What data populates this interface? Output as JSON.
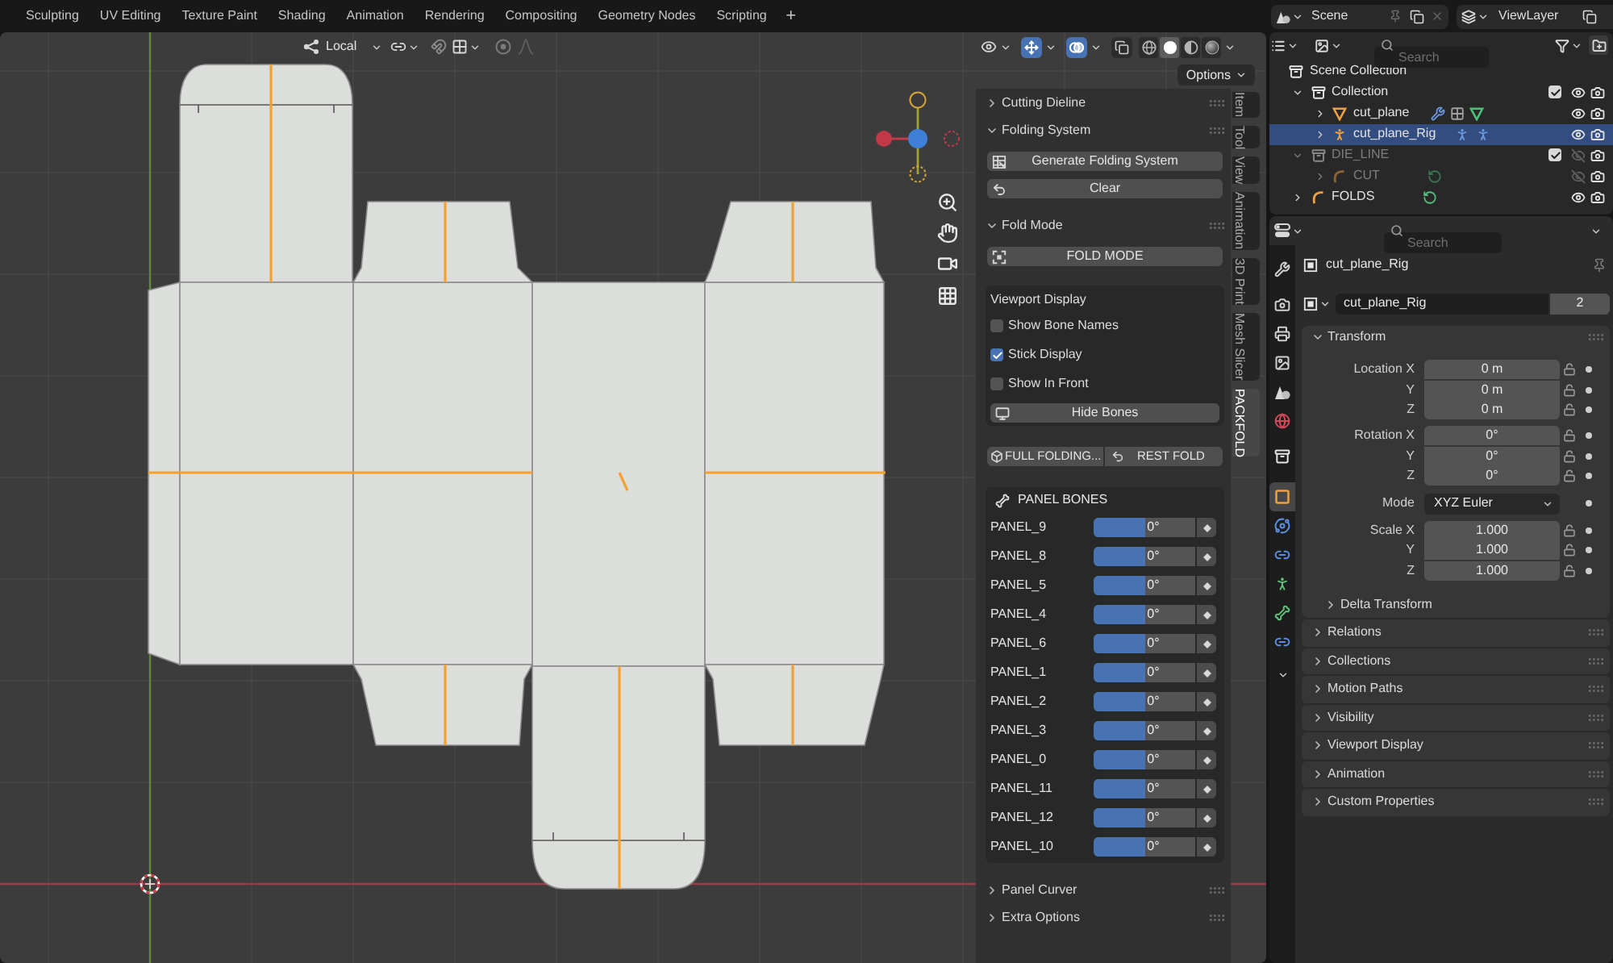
{
  "topbar": {
    "workspaces": [
      "Sculpting",
      "UV Editing",
      "Texture Paint",
      "Shading",
      "Animation",
      "Rendering",
      "Compositing",
      "Geometry Nodes",
      "Scripting"
    ],
    "add_label": "+",
    "scene": "Scene",
    "view_layer": "ViewLayer"
  },
  "viewport": {
    "header": {
      "orientation": "Local",
      "toggles": [
        {
          "kind": "gizmos",
          "on": true
        },
        {
          "kind": "overlays",
          "on": true
        },
        {
          "kind": "xray",
          "on": false
        }
      ],
      "shading": [
        {
          "kind": "wireframe",
          "selected": false
        },
        {
          "kind": "solid",
          "selected": true
        },
        {
          "kind": "material",
          "selected": false
        },
        {
          "kind": "rendered",
          "selected": false
        }
      ]
    },
    "options_label": "Options"
  },
  "sidebar": {
    "panels": [
      {
        "title": "Cutting Dieline",
        "expanded": false
      },
      {
        "title": "Folding System",
        "expanded": true,
        "buttons": [
          {
            "label": "Generate Folding System"
          },
          {
            "label": "Clear"
          }
        ]
      },
      {
        "title": "Fold Mode",
        "expanded": true,
        "buttons": [
          {
            "label": "FOLD MODE"
          }
        ],
        "display_box": {
          "title": "Viewport Display",
          "options": [
            {
              "label": "Show Bone Names",
              "checked": false
            },
            {
              "label": "Stick Display",
              "checked": true
            },
            {
              "label": "Show In Front",
              "checked": false
            }
          ],
          "button": "Hide Bones"
        },
        "actions": [
          {
            "label": "FULL FOLDING..."
          },
          {
            "label": "REST FOLD"
          }
        ],
        "bones": {
          "title": "PANEL BONES",
          "rows": [
            {
              "name": "PANEL_9",
              "value": "0°",
              "level": 0.5
            },
            {
              "name": "PANEL_8",
              "value": "0°",
              "level": 0.5
            },
            {
              "name": "PANEL_5",
              "value": "0°",
              "level": 0.5
            },
            {
              "name": "PANEL_4",
              "value": "0°",
              "level": 0.5
            },
            {
              "name": "PANEL_6",
              "value": "0°",
              "level": 0.5
            },
            {
              "name": "PANEL_1",
              "value": "0°",
              "level": 0.5
            },
            {
              "name": "PANEL_2",
              "value": "0°",
              "level": 0.5
            },
            {
              "name": "PANEL_3",
              "value": "0°",
              "level": 0.5
            },
            {
              "name": "PANEL_0",
              "value": "0°",
              "level": 0.5
            },
            {
              "name": "PANEL_11",
              "value": "0°",
              "level": 0.5
            },
            {
              "name": "PANEL_12",
              "value": "0°",
              "level": 0.5
            },
            {
              "name": "PANEL_10",
              "value": "0°",
              "level": 0.5
            }
          ]
        }
      },
      {
        "title": "Panel Curver",
        "expanded": false
      },
      {
        "title": "Extra Options",
        "expanded": false
      }
    ],
    "tabs": [
      {
        "label": "Item",
        "selected": false
      },
      {
        "label": "Tool",
        "selected": false
      },
      {
        "label": "View",
        "selected": false
      },
      {
        "label": "Animation",
        "selected": false
      },
      {
        "label": "3D Print",
        "selected": false
      },
      {
        "label": "Mesh Slicer",
        "selected": false
      },
      {
        "label": "PACKFOLD",
        "selected": true
      }
    ]
  },
  "outliner": {
    "search": {
      "placeholder": "Search"
    },
    "tree": [
      {
        "name": "Scene Collection",
        "kind": "scene_collection",
        "selected": false,
        "children": [
          {
            "name": "Collection",
            "kind": "collection",
            "expanded": true,
            "checked": true,
            "hidden": false,
            "selected": false,
            "children": [
              {
                "name": "cut_plane",
                "kind": "mesh",
                "expanded": false,
                "hidden": false,
                "selected": false
              },
              {
                "name": "cut_plane_Rig",
                "kind": "armature",
                "expanded": false,
                "hidden": false,
                "selected": true
              }
            ]
          },
          {
            "name": "DIE_LINE",
            "kind": "collection",
            "expanded": true,
            "checked": true,
            "hidden": true,
            "selected": false,
            "children": [
              {
                "name": "CUT",
                "kind": "curve",
                "expanded": false,
                "hidden": true,
                "selected": false
              }
            ]
          },
          {
            "name": "FOLDS",
            "kind": "curve",
            "expanded": false,
            "hidden": false,
            "selected": false
          }
        ]
      }
    ]
  },
  "properties": {
    "search": {
      "placeholder": "Search"
    },
    "tabs": [
      {
        "kind": "tool",
        "selected": false
      },
      {
        "kind": "render",
        "selected": false
      },
      {
        "kind": "output",
        "selected": false
      },
      {
        "kind": "view_layer",
        "selected": false
      },
      {
        "kind": "scene",
        "selected": false
      },
      {
        "kind": "world",
        "selected": false
      },
      {
        "kind": "collection",
        "selected": false
      },
      {
        "kind": "object",
        "selected": true
      },
      {
        "kind": "physics",
        "selected": false
      },
      {
        "kind": "object_constraints",
        "selected": false
      },
      {
        "kind": "armature_data",
        "selected": false
      },
      {
        "kind": "bone",
        "selected": false
      },
      {
        "kind": "bone_constraints",
        "selected": false
      }
    ],
    "object_name": "cut_plane_Rig",
    "datablock": {
      "name": "cut_plane_Rig",
      "users": "2"
    },
    "transform": {
      "title": "Transform",
      "expanded": true,
      "groups": [
        {
          "kind": "vector",
          "rows": [
            {
              "label": "Location X",
              "value": "0 m"
            },
            {
              "label": "Y",
              "value": "0 m"
            },
            {
              "label": "Z",
              "value": "0 m"
            }
          ]
        },
        {
          "kind": "vector",
          "rows": [
            {
              "label": "Rotation X",
              "value": "0°"
            },
            {
              "label": "Y",
              "value": "0°"
            },
            {
              "label": "Z",
              "value": "0°"
            }
          ]
        },
        {
          "kind": "enum",
          "label": "Mode",
          "value": "XYZ Euler"
        },
        {
          "kind": "vector",
          "rows": [
            {
              "label": "Scale X",
              "value": "1.000"
            },
            {
              "label": "Y",
              "value": "1.000"
            },
            {
              "label": "Z",
              "value": "1.000"
            }
          ]
        }
      ],
      "subpanels": [
        {
          "title": "Delta Transform",
          "expanded": false
        }
      ]
    },
    "panels": [
      {
        "title": "Relations",
        "expanded": false
      },
      {
        "title": "Collections",
        "expanded": false
      },
      {
        "title": "Motion Paths",
        "expanded": false
      },
      {
        "title": "Visibility",
        "expanded": false
      },
      {
        "title": "Viewport Display",
        "expanded": false
      },
      {
        "title": "Animation",
        "expanded": false
      },
      {
        "title": "Custom Properties",
        "expanded": false
      }
    ]
  }
}
